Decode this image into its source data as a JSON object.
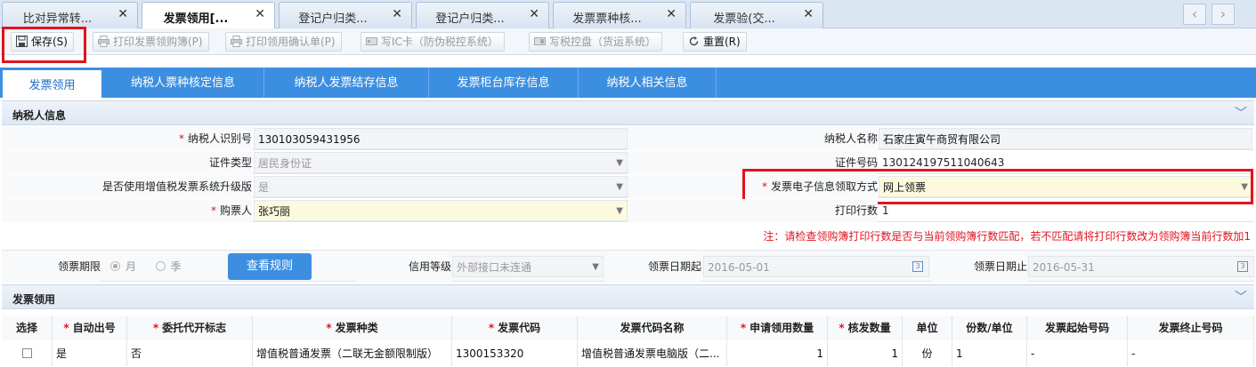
{
  "tabs": [
    {
      "label": "比对异常转..."
    },
    {
      "label": "发票领用[..."
    },
    {
      "label": "登记户归类..."
    },
    {
      "label": "登记户归类..."
    },
    {
      "label": "发票票种核..."
    },
    {
      "label": "发票验(交..."
    }
  ],
  "toolbar": {
    "save": "保存(S)",
    "print_book": "打印发票领购簿(P)",
    "print_confirm": "打印领用确认单(P)",
    "write_ic": "写IC卡（防伪税控系统）",
    "write_disk": "写税控盘（货运系统）",
    "reset": "重置(R)"
  },
  "subtabs": [
    "发票领用",
    "纳税人票种核定信息",
    "纳税人发票结存信息",
    "发票柜台库存信息",
    "纳税人相关信息"
  ],
  "taxpayer": {
    "section_title": "纳税人信息",
    "id_label": "纳税人识别号",
    "id_value": "130103059431956",
    "name_label": "纳税人名称",
    "name_value": "石家庄寅午商贸有限公司",
    "cert_type_label": "证件类型",
    "cert_type_value": "居民身份证",
    "cert_no_label": "证件号码",
    "cert_no_value": "130124197511040643",
    "upgrade_label": "是否使用增值税发票系统升级版",
    "upgrade_value": "是",
    "e_method_label": "发票电子信息领取方式",
    "e_method_value": "网上领票",
    "buyer_label": "购票人",
    "buyer_value": "张巧丽",
    "print_rows_label": "打印行数",
    "print_rows_value": "1",
    "note": "注：请检查领购簿打印行数是否与当前领购簿行数匹配，若不匹配请将打印行数改为领购簿当前行数加1"
  },
  "period": {
    "label": "领票期限",
    "month": "月",
    "season": "季",
    "rules_button": "查看规则",
    "credit_label": "信用等级",
    "credit_value": "外部接口未连通",
    "start_label": "领票日期起",
    "start_value": "2016-05-01",
    "end_label": "领票日期止",
    "end_value": "2016-05-31"
  },
  "invoice": {
    "section_title": "发票领用",
    "headers": [
      "选择",
      "自动出号",
      "委托代开标志",
      "发票种类",
      "发票代码",
      "发票代码名称",
      "申请领用数量",
      "核发数量",
      "单位",
      "份数/单位",
      "发票起始号码",
      "发票终止号码"
    ],
    "row": [
      "",
      "是",
      "否",
      "增值税普通发票（二联无金额限制版）",
      "1300153320",
      "增值税普通发票电脑版（二...",
      "1",
      "1",
      "份",
      "1",
      "-",
      "-"
    ]
  },
  "colors": {
    "accent": "#3c8fe0",
    "highlight": "#e0141e"
  }
}
